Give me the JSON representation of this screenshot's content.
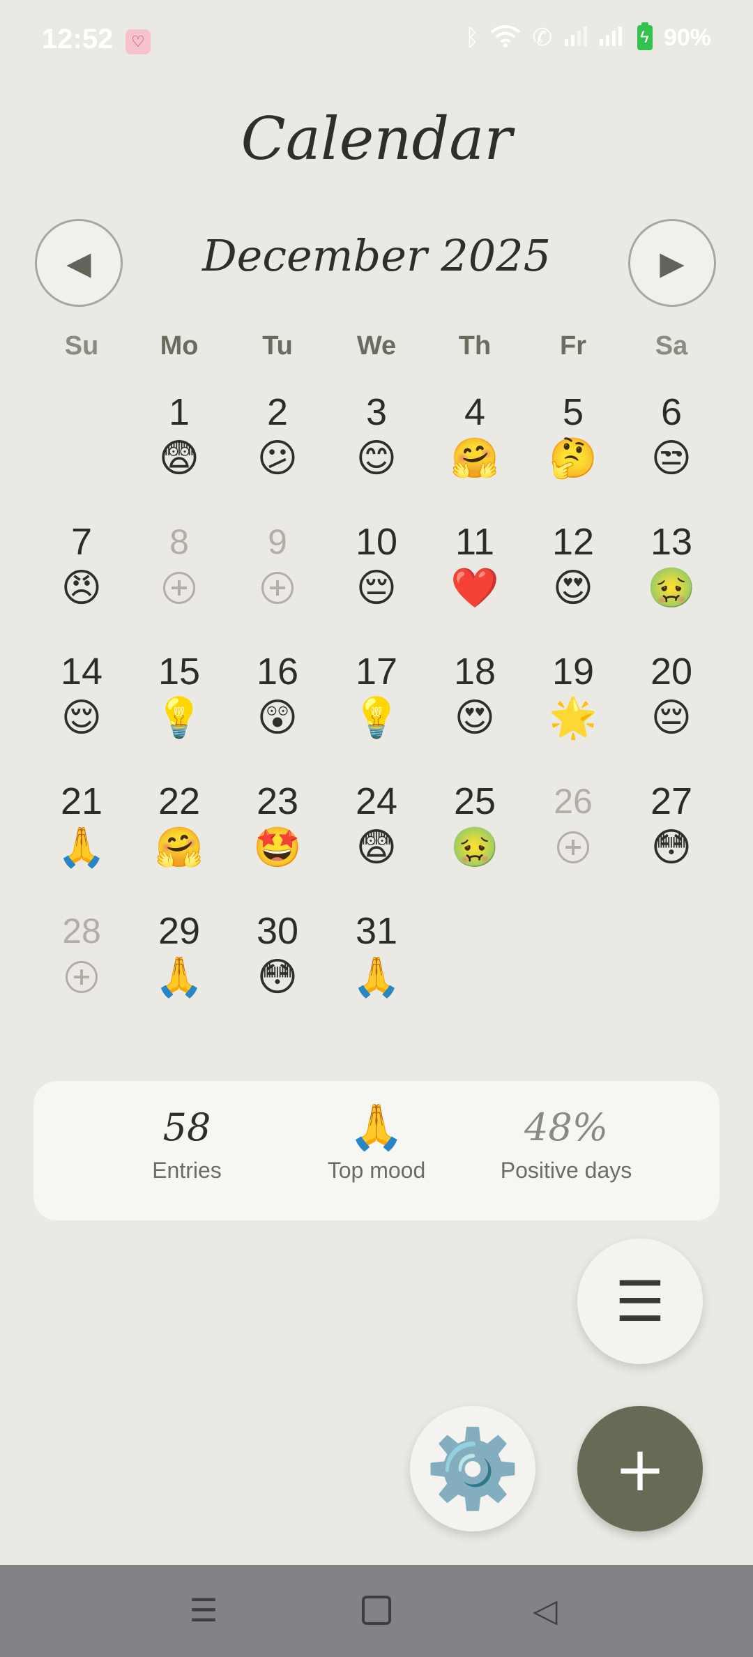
{
  "status_bar": {
    "time": "12:52",
    "battery": "90%",
    "icons": [
      "bluetooth-icon",
      "wifi-icon",
      "volte-call-icon",
      "signal-icon",
      "signal-icon",
      "battery-charging-icon"
    ]
  },
  "title": "Calendar",
  "month_label": "December 2025",
  "nav": {
    "prev_symbol": "◀",
    "next_symbol": "▶"
  },
  "weekdays": [
    {
      "label": "Su",
      "color": "#8a8a80"
    },
    {
      "label": "Mo",
      "color": "#6a6c5e"
    },
    {
      "label": "Tu",
      "color": "#6a6c5e"
    },
    {
      "label": "We",
      "color": "#6a6c5e"
    },
    {
      "label": "Th",
      "color": "#6a6c5e"
    },
    {
      "label": "Fr",
      "color": "#6a6c5e"
    },
    {
      "label": "Sa",
      "color": "#8a8a80"
    }
  ],
  "days": [
    {
      "num": "1",
      "mood": "😨",
      "col": 1,
      "row": 0
    },
    {
      "num": "2",
      "mood": "😕",
      "col": 2,
      "row": 0
    },
    {
      "num": "3",
      "mood": "😊",
      "col": 3,
      "row": 0
    },
    {
      "num": "4",
      "mood": "🤗",
      "col": 4,
      "row": 0
    },
    {
      "num": "5",
      "mood": "🤔",
      "col": 5,
      "row": 0
    },
    {
      "num": "6",
      "mood": "😒",
      "col": 6,
      "row": 0
    },
    {
      "num": "7",
      "mood": "😠",
      "col": 0,
      "row": 1
    },
    {
      "num": "8",
      "mood": null,
      "col": 1,
      "row": 1
    },
    {
      "num": "9",
      "mood": null,
      "col": 2,
      "row": 1
    },
    {
      "num": "10",
      "mood": "😔",
      "col": 3,
      "row": 1
    },
    {
      "num": "11",
      "mood": "❤️",
      "col": 4,
      "row": 1
    },
    {
      "num": "12",
      "mood": "😍",
      "col": 5,
      "row": 1
    },
    {
      "num": "13",
      "mood": "🤢",
      "col": 6,
      "row": 1
    },
    {
      "num": "14",
      "mood": "😌",
      "col": 0,
      "row": 2
    },
    {
      "num": "15",
      "mood": "💡",
      "col": 1,
      "row": 2
    },
    {
      "num": "16",
      "mood": "😲",
      "col": 2,
      "row": 2
    },
    {
      "num": "17",
      "mood": "💡",
      "col": 3,
      "row": 2
    },
    {
      "num": "18",
      "mood": "😍",
      "col": 4,
      "row": 2
    },
    {
      "num": "19",
      "mood": "🌟",
      "col": 5,
      "row": 2
    },
    {
      "num": "20",
      "mood": "😔",
      "col": 6,
      "row": 2
    },
    {
      "num": "21",
      "mood": "🙏",
      "col": 0,
      "row": 3
    },
    {
      "num": "22",
      "mood": "🤗",
      "col": 1,
      "row": 3
    },
    {
      "num": "23",
      "mood": "🤩",
      "col": 2,
      "row": 3
    },
    {
      "num": "24",
      "mood": "😨",
      "col": 3,
      "row": 3
    },
    {
      "num": "25",
      "mood": "🤢",
      "col": 4,
      "row": 3
    },
    {
      "num": "26",
      "mood": null,
      "col": 5,
      "row": 3
    },
    {
      "num": "27",
      "mood": "😳",
      "col": 6,
      "row": 3
    },
    {
      "num": "28",
      "mood": null,
      "col": 0,
      "row": 4
    },
    {
      "num": "29",
      "mood": "🙏",
      "col": 1,
      "row": 4
    },
    {
      "num": "30",
      "mood": "😳",
      "col": 2,
      "row": 4
    },
    {
      "num": "31",
      "mood": "🙏",
      "col": 3,
      "row": 4
    }
  ],
  "stats": {
    "entries_value": "58",
    "entries_label": "Entries",
    "top_mood_value": "🙏",
    "top_mood_label": "Top mood",
    "positive_value": "48%",
    "positive_label": "Positive days"
  },
  "fabs": {
    "menu_symbol": "☰",
    "settings_symbol": "⚙️",
    "add_symbol": "+"
  },
  "navbar": {
    "menu_symbol": "☰",
    "back_symbol": "◁"
  },
  "colors": {
    "background": "#ebe9e3",
    "accent": "#666b55",
    "muted": "#b0aea7"
  }
}
